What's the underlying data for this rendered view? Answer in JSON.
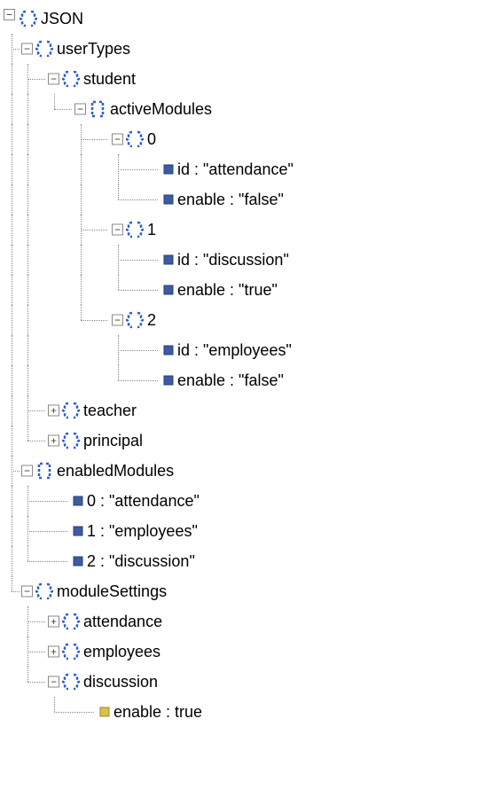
{
  "root": {
    "label": "JSON",
    "userTypes": {
      "label": "userTypes",
      "student": {
        "label": "student",
        "activeModules": {
          "label": "activeModules",
          "items": [
            {
              "index": "0",
              "id_label": "id : \"attendance\"",
              "enable_label": "enable : \"false\""
            },
            {
              "index": "1",
              "id_label": "id : \"discussion\"",
              "enable_label": "enable : \"true\""
            },
            {
              "index": "2",
              "id_label": "id : \"employees\"",
              "enable_label": "enable : \"false\""
            }
          ]
        }
      },
      "teacher": {
        "label": "teacher"
      },
      "principal": {
        "label": "principal"
      }
    },
    "enabledModules": {
      "label": "enabledModules",
      "items": [
        {
          "label": "0 : \"attendance\""
        },
        {
          "label": "1 : \"employees\""
        },
        {
          "label": "2 : \"discussion\""
        }
      ]
    },
    "moduleSettings": {
      "label": "moduleSettings",
      "attendance": {
        "label": "attendance"
      },
      "employees": {
        "label": "employees"
      },
      "discussion": {
        "label": "discussion",
        "enable": {
          "label": "enable : true"
        }
      }
    }
  },
  "glyphs": {
    "minus": "−",
    "plus": "+"
  }
}
